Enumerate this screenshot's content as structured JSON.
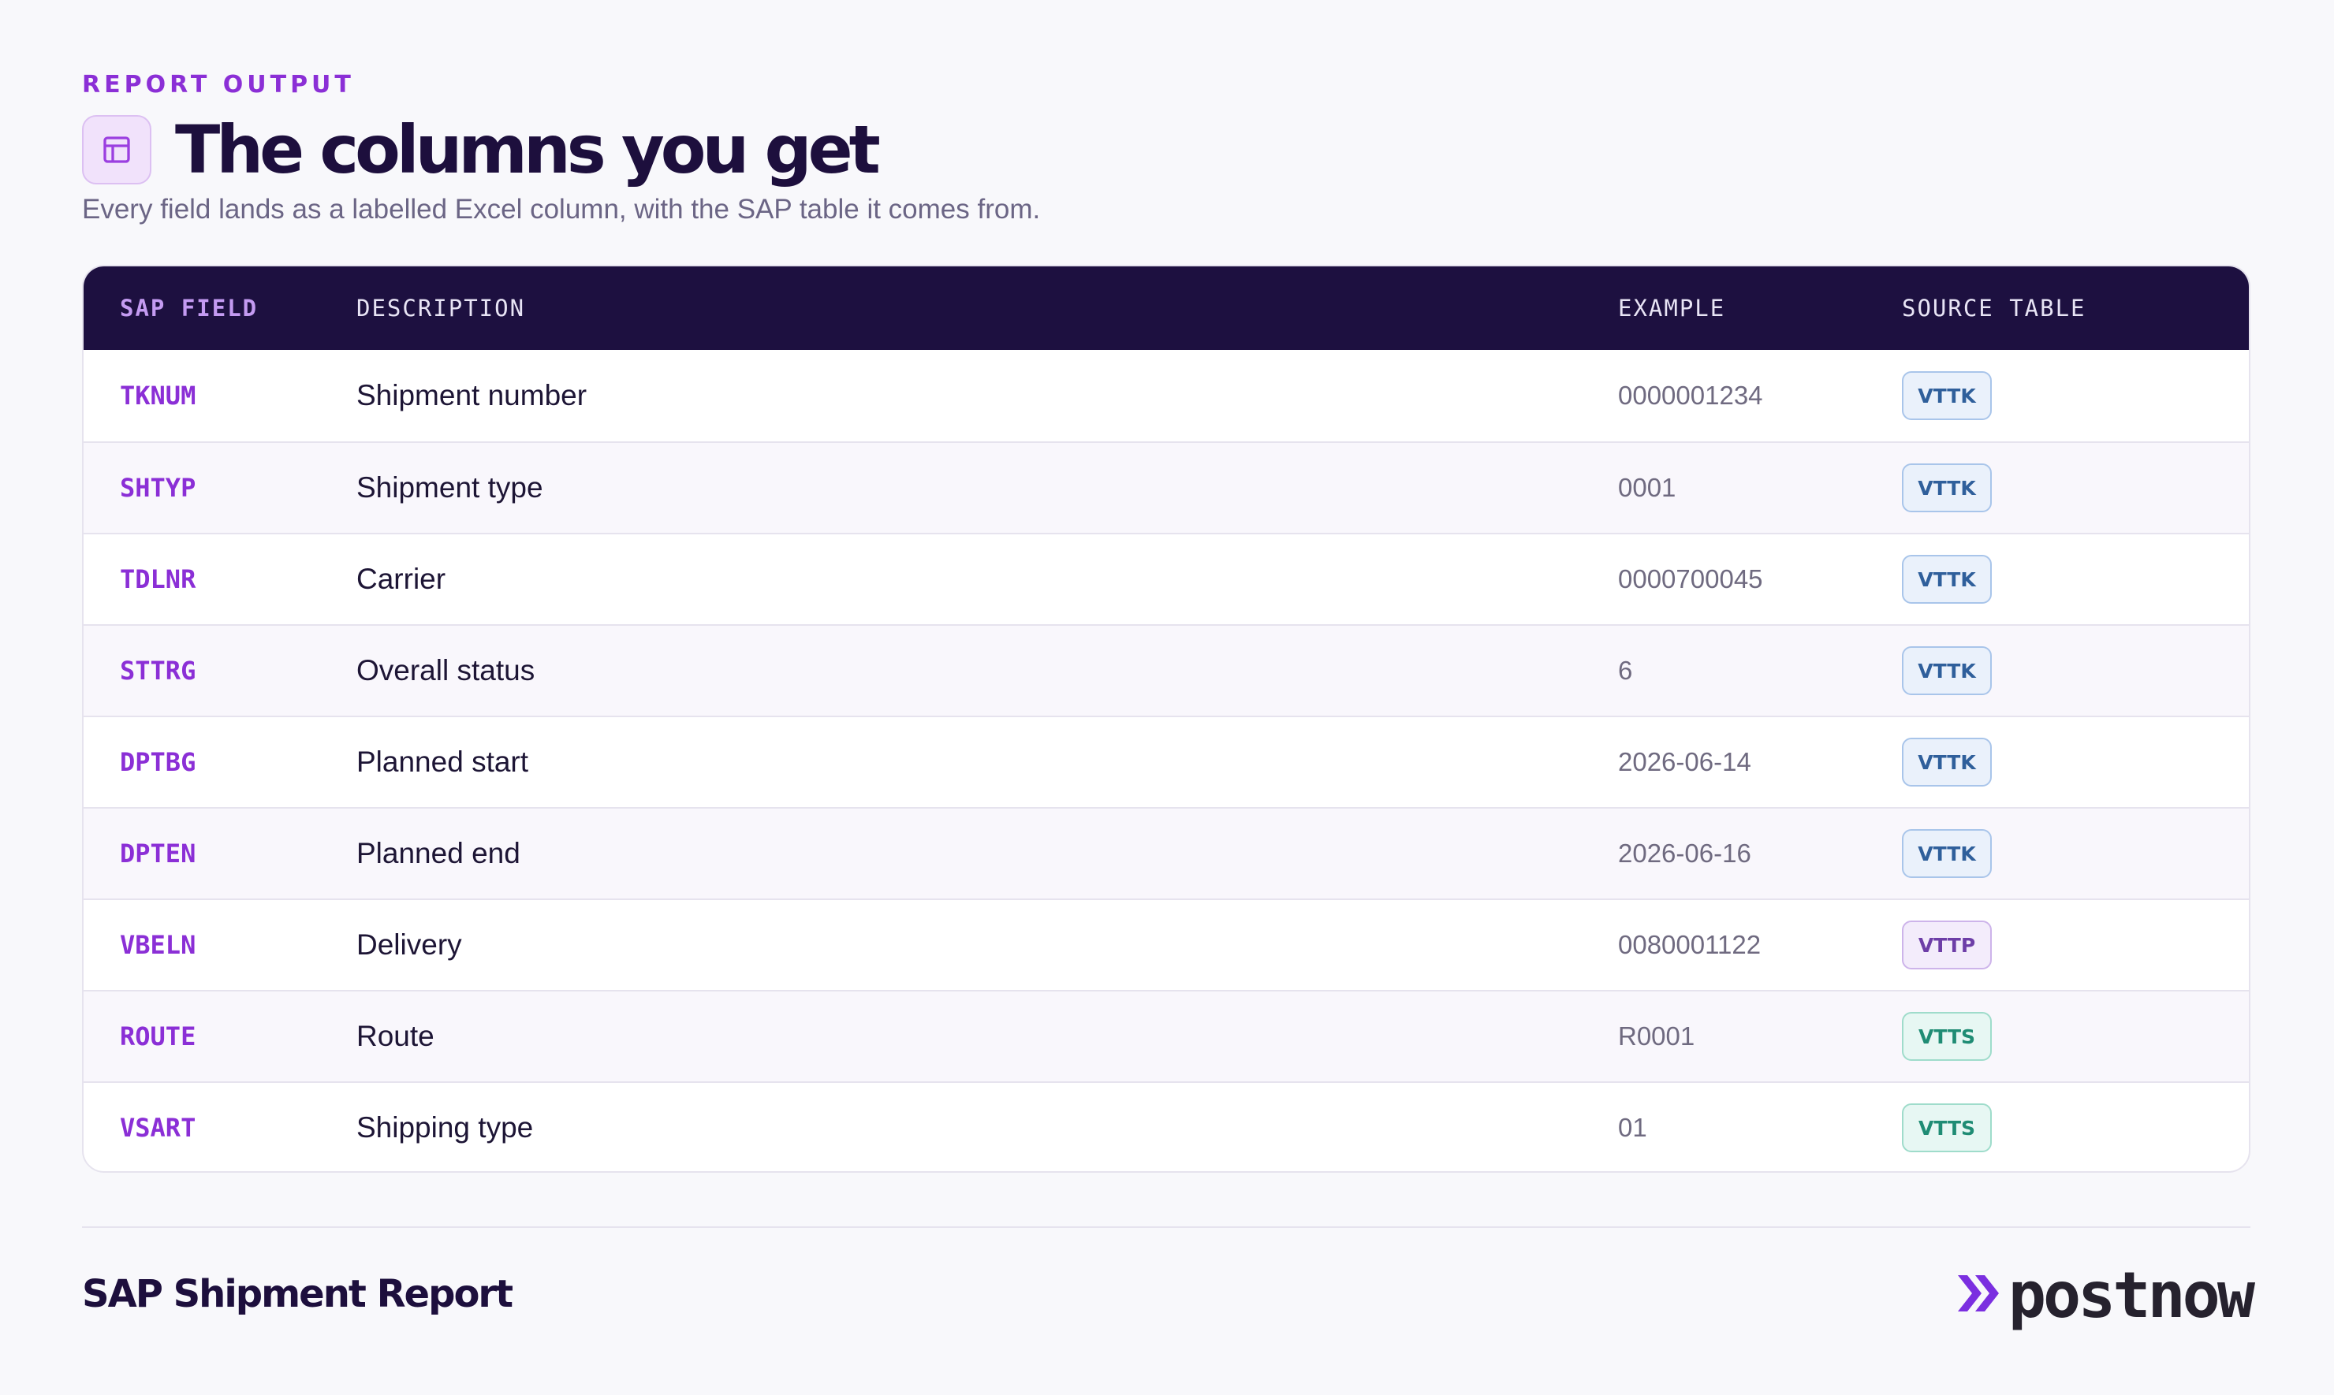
{
  "header": {
    "eyebrow": "REPORT OUTPUT",
    "title": "The columns you get",
    "subtitle": "Every field lands as a labelled Excel column, with the SAP table it comes from.",
    "icon": "table-layout-icon"
  },
  "table": {
    "columns": [
      "SAP FIELD",
      "DESCRIPTION",
      "EXAMPLE",
      "SOURCE TABLE"
    ],
    "rows": [
      {
        "field": "TKNUM",
        "description": "Shipment number",
        "example": "0000001234",
        "source": "VTTK"
      },
      {
        "field": "SHTYP",
        "description": "Shipment type",
        "example": "0001",
        "source": "VTTK"
      },
      {
        "field": "TDLNR",
        "description": "Carrier",
        "example": "0000700045",
        "source": "VTTK"
      },
      {
        "field": "STTRG",
        "description": "Overall status",
        "example": "6",
        "source": "VTTK"
      },
      {
        "field": "DPTBG",
        "description": "Planned start",
        "example": "2026-06-14",
        "source": "VTTK"
      },
      {
        "field": "DPTEN",
        "description": "Planned end",
        "example": "2026-06-16",
        "source": "VTTK"
      },
      {
        "field": "VBELN",
        "description": "Delivery",
        "example": "0080001122",
        "source": "VTTP"
      },
      {
        "field": "ROUTE",
        "description": "Route",
        "example": "R0001",
        "source": "VTTS"
      },
      {
        "field": "VSART",
        "description": "Shipping type",
        "example": "01",
        "source": "VTTS"
      }
    ]
  },
  "footer": {
    "title": "SAP Shipment Report",
    "logo_text": "postnow",
    "logo_icon": "double-chevron-right-icon"
  },
  "colors": {
    "accent": "#8b2fd6",
    "header_bg": "#1d1040",
    "badge_vttk": "#2f5f9b",
    "badge_vttp": "#6d3ea7",
    "badge_vtts": "#1f8c74"
  }
}
